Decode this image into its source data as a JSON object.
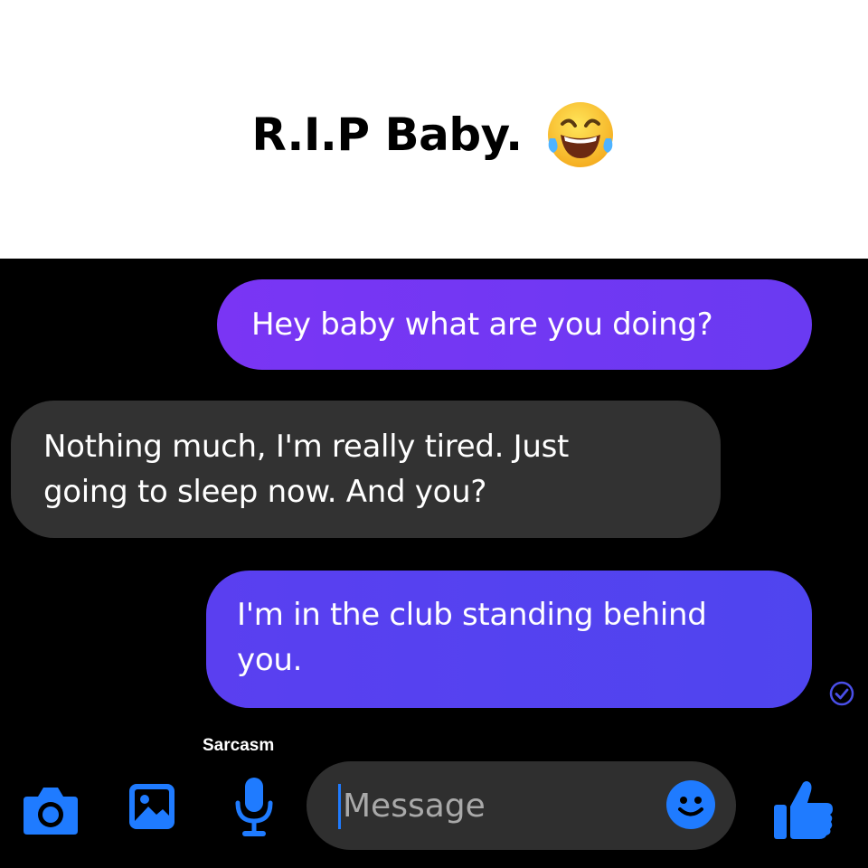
{
  "caption": {
    "text": "R.I.P Baby.",
    "emoji": "face-with-tears-of-joy-icon"
  },
  "conversation": {
    "messages": [
      {
        "sender": "me",
        "text": "Hey baby what are you doing?"
      },
      {
        "sender": "other",
        "lines": [
          "Nothing much, I'm really tired. Just",
          "going to sleep now. And you?"
        ]
      },
      {
        "sender": "me",
        "lines": [
          "I'm in the club standing behind",
          "you."
        ]
      }
    ],
    "status_icon": "delivered-check-icon"
  },
  "watermark": "Sarcasm",
  "composer": {
    "placeholder": "Message",
    "icons": [
      "camera-icon",
      "gallery-icon",
      "microphone-icon",
      "emoji-icon",
      "thumbs-up-icon"
    ]
  },
  "colors": {
    "accent_blue": "#1f7bff",
    "sent_bubble": "#6a3af2",
    "received_bubble": "#323232",
    "chat_background": "#000000"
  }
}
